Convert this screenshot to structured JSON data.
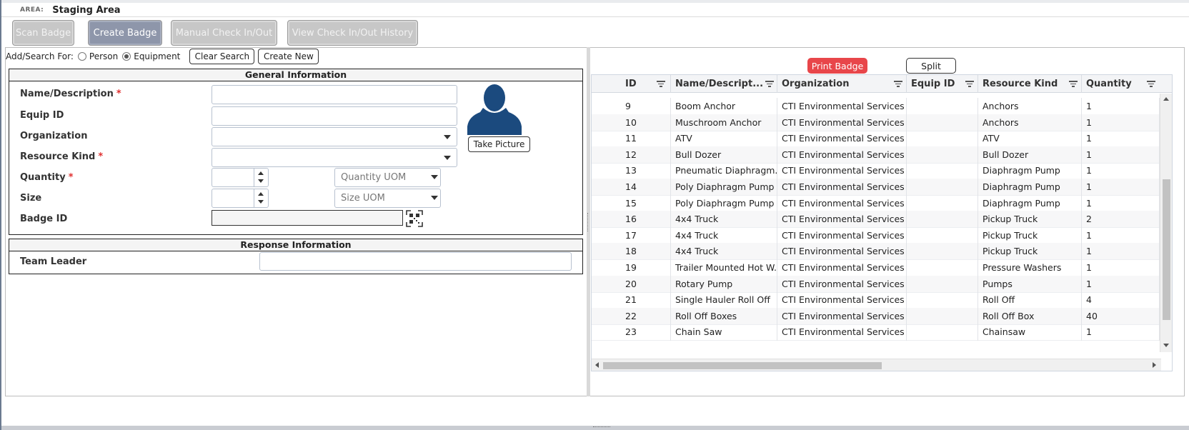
{
  "area": {
    "label": "AREA:",
    "value": "Staging Area"
  },
  "tabs": [
    {
      "label": "Scan Badge",
      "active": false
    },
    {
      "label": "Create Badge",
      "active": true
    },
    {
      "label": "Manual Check In/Out",
      "active": false
    },
    {
      "label": "View Check In/Out History",
      "active": false
    }
  ],
  "search": {
    "prefix": "Add/Search For:",
    "option_person": "Person",
    "option_equipment": "Equipment",
    "selected": "Equipment",
    "clear_label": "Clear Search",
    "new_label": "Create New"
  },
  "general": {
    "title": "General Information",
    "name_label": "Name/Description",
    "equip_label": "Equip ID",
    "org_label": "Organization",
    "kind_label": "Resource Kind",
    "qty_label": "Quantity",
    "size_label": "Size",
    "badge_label": "Badge ID",
    "required_mark": "*",
    "qty_uom_placeholder": "Quantity UOM",
    "size_uom_placeholder": "Size UOM",
    "take_picture": "Take Picture"
  },
  "response": {
    "title": "Response Information",
    "team_leader_label": "Team Leader"
  },
  "grid_actions": {
    "print_badge": "Print Badge",
    "split": "Split",
    "print_color": "#e8464a"
  },
  "grid": {
    "columns": [
      "ID",
      "Name/Descript...",
      "Organization",
      "Equip ID",
      "Resource Kind",
      "Quantity"
    ],
    "rows": [
      [
        "9",
        "Boom Anchor",
        "CTI Environmental Services",
        "",
        "Anchors",
        "1"
      ],
      [
        "10",
        "Muschroom Anchor",
        "CTI Environmental Services",
        "",
        "Anchors",
        "1"
      ],
      [
        "11",
        "ATV",
        "CTI Environmental Services",
        "",
        "ATV",
        "1"
      ],
      [
        "12",
        "Bull Dozer",
        "CTI Environmental Services",
        "",
        "Bull Dozer",
        "1"
      ],
      [
        "13",
        "Pneumatic Diaphragm...",
        "CTI Environmental Services",
        "",
        "Diaphragm Pump",
        "1"
      ],
      [
        "14",
        "Poly Diaphragm Pump",
        "CTI Environmental Services",
        "",
        "Diaphragm Pump",
        "1"
      ],
      [
        "15",
        "Poly Diaphragm Pump",
        "CTI Environmental Services",
        "",
        "Diaphragm Pump",
        "1"
      ],
      [
        "16",
        "4x4 Truck",
        "CTI Environmental Services",
        "",
        "Pickup Truck",
        "2"
      ],
      [
        "17",
        "4x4 Truck",
        "CTI Environmental Services",
        "",
        "Pickup Truck",
        "1"
      ],
      [
        "18",
        "4x4 Truck",
        "CTI Environmental Services",
        "",
        "Pickup Truck",
        "1"
      ],
      [
        "19",
        "Trailer Mounted Hot W...",
        "CTI Environmental Services",
        "",
        "Pressure Washers",
        "1"
      ],
      [
        "20",
        "Rotary Pump",
        "CTI Environmental Services",
        "",
        "Pumps",
        "1"
      ],
      [
        "21",
        "Single Hauler Roll Off",
        "CTI Environmental Services",
        "",
        "Roll Off",
        "4"
      ],
      [
        "22",
        "Roll Off Boxes",
        "CTI Environmental Services",
        "",
        "Roll Off Box",
        "40"
      ],
      [
        "23",
        "Chain Saw",
        "CTI Environmental Services",
        "",
        "Chainsaw",
        "1"
      ]
    ]
  },
  "colors": {
    "avatar": "#1b4a7e",
    "active_tab": "#8e96aa",
    "inactive_tab": "#c7c7c7"
  }
}
